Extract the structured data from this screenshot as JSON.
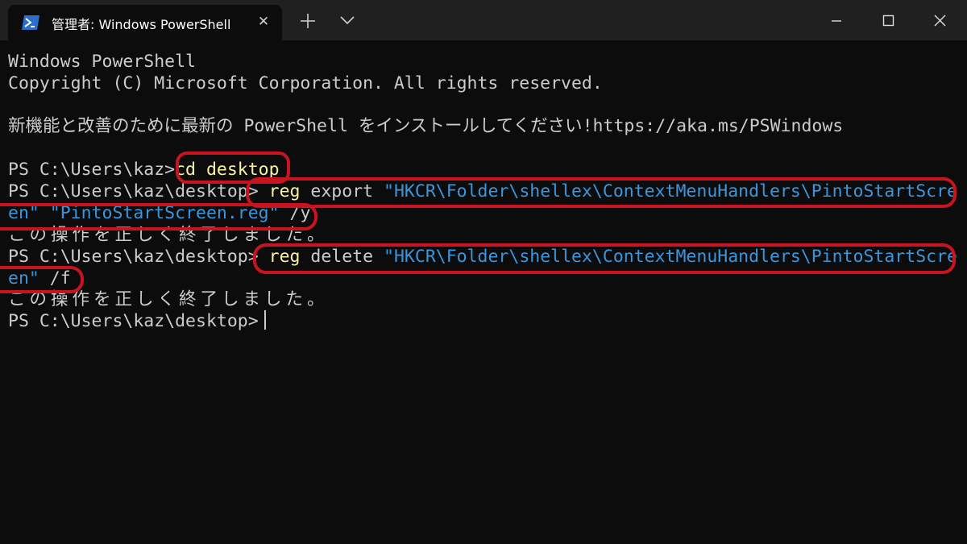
{
  "window": {
    "tab_title": "管理者: Windows PowerShell",
    "tab_icon": "powershell-icon",
    "tab_close_label": "✕",
    "new_tab_icon": "plus-icon",
    "dropdown_icon": "chevron-down-icon",
    "controls": [
      "minimize-icon",
      "maximize-icon",
      "close-icon"
    ]
  },
  "console": {
    "banner_line1": "Windows PowerShell",
    "banner_line2": "Copyright (C) Microsoft Corporation. All rights reserved.",
    "notice": "新機能と改善のために最新の PowerShell をインストールしてください!https://aka.ms/PSWindows",
    "prompt1": "PS C:\\Users\\kaz>",
    "cmd1": "cd desktop",
    "prompt2": "PS C:\\Users\\kaz\\desktop>",
    "cmd2": "reg",
    "cmd2_verb": "export",
    "cmd2_str1_part1": "\"HKCR\\Folder\\shellex\\ContextMenuHandlers\\PintoStartScre",
    "cmd2_str1_part2": "en\"",
    "cmd2_str2": "\"PintoStartScreen.reg\"",
    "cmd2_flag": "/y",
    "result1": "この操作を正しく終了しました。",
    "prompt3": "PS C:\\Users\\kaz\\desktop>",
    "cmd3": "reg",
    "cmd3_verb": "delete",
    "cmd3_str1_part1": "\"HKCR\\Folder\\shellex\\ContextMenuHandlers\\PintoStartScre",
    "cmd3_str1_part2": "en\"",
    "cmd3_flag": "/f",
    "result2": "この操作を正しく終了しました。",
    "prompt4": "PS C:\\Users\\kaz\\desktop>"
  },
  "colors": {
    "background": "#0c0c0c",
    "titlebar": "#202020",
    "text": "#cccccc",
    "command": "#f9f1a5",
    "string": "#3a96dd",
    "highlight": "#c8141e"
  }
}
